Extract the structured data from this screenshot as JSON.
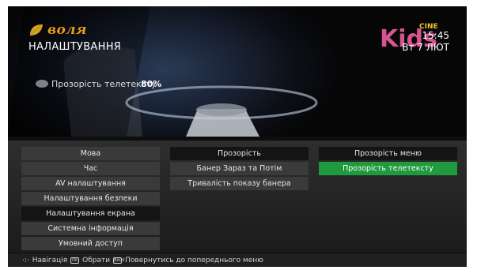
{
  "header": {
    "brand": "воля",
    "title": "НАЛАШТУВАННЯ",
    "channel_logo": "Kids",
    "channel_logo_sub": "CINE",
    "time": "15:45",
    "date": "Вт 7 ЛЮТ"
  },
  "preview": {
    "label": "Прозорість телетексту",
    "value": "80%"
  },
  "menu": {
    "column1": [
      {
        "label": "Мова"
      },
      {
        "label": "Час"
      },
      {
        "label": "AV налаштування"
      },
      {
        "label": "Налаштування безпеки"
      },
      {
        "label": "Налаштування екрана"
      },
      {
        "label": "Системна інформація"
      },
      {
        "label": "Умовний доступ"
      }
    ],
    "column2": [
      {
        "label": "Прозорість"
      },
      {
        "label": "Банер Зараз та Потім"
      },
      {
        "label": "Тривалість показу банера"
      }
    ],
    "column3": [
      {
        "label": "Прозорість меню"
      },
      {
        "label": "Прозорість телетексту"
      }
    ]
  },
  "footer": {
    "nav": "Навігація",
    "ok_key": "OK",
    "select": "Обрати",
    "back_key": "BACK",
    "back": "Повернутись до попереднього меню"
  },
  "colors": {
    "accent": "#1f9a3c",
    "brand": "#e89a19"
  }
}
